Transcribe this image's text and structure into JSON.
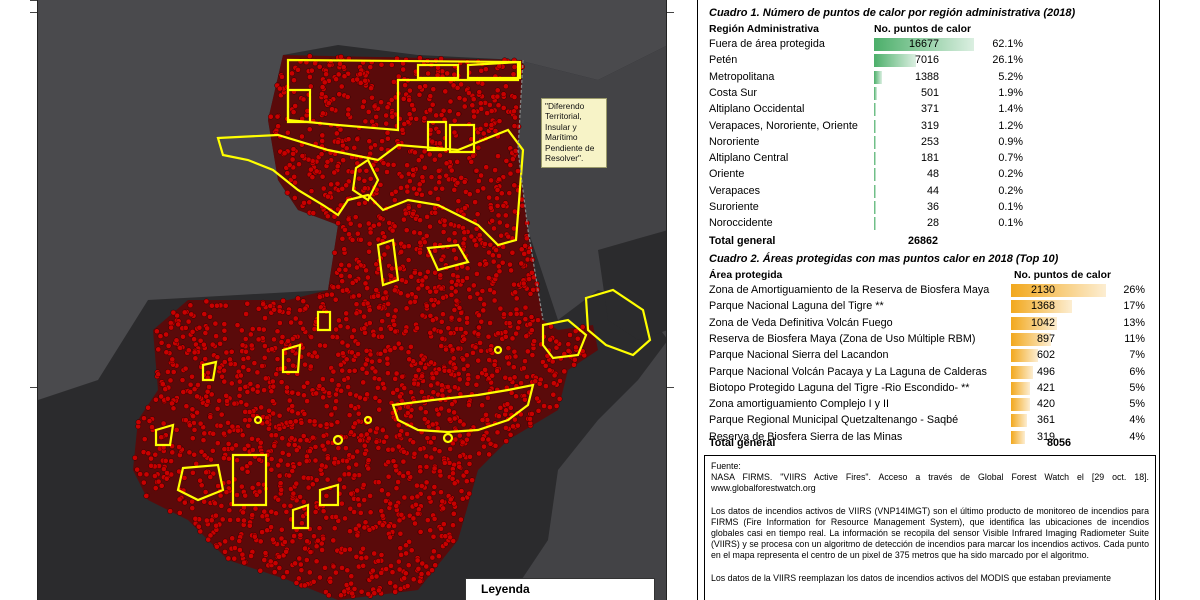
{
  "map": {
    "dispute_note": "\"Diferendo Territorial, Insular y Marítimo Pendiente de Resolver\".",
    "legend_title": "Leyenda"
  },
  "cuadro1": {
    "title": "Cuadro 1. Número de puntos de calor por región administrativa (2018)",
    "col_region": "Región Administrativa",
    "col_count": "No. puntos de calor",
    "bar_color": "#4caf6a",
    "rows": [
      {
        "region": "Fuera de área protegida",
        "count": 16677,
        "pct": "62.1%"
      },
      {
        "region": "Petén",
        "count": 7016,
        "pct": "26.1%"
      },
      {
        "region": "Metropolitana",
        "count": 1388,
        "pct": "5.2%"
      },
      {
        "region": "Costa Sur",
        "count": 501,
        "pct": "1.9%"
      },
      {
        "region": "Altiplano Occidental",
        "count": 371,
        "pct": "1.4%"
      },
      {
        "region": "Verapaces, Nororiente, Oriente",
        "count": 319,
        "pct": "1.2%"
      },
      {
        "region": "Nororiente",
        "count": 253,
        "pct": "0.9%"
      },
      {
        "region": "Altiplano Central",
        "count": 181,
        "pct": "0.7%"
      },
      {
        "region": "Oriente",
        "count": 48,
        "pct": "0.2%"
      },
      {
        "region": "Verapaces",
        "count": 44,
        "pct": "0.2%"
      },
      {
        "region": "Suroriente",
        "count": 36,
        "pct": "0.1%"
      },
      {
        "region": "Noroccidente",
        "count": 28,
        "pct": "0.1%"
      }
    ],
    "total_label": "Total general",
    "total_value": "26862"
  },
  "cuadro2": {
    "title": "Cuadro 2. Áreas protegidas con mas puntos calor en 2018 (Top 10)",
    "col_area": "Área protegida",
    "col_count": "No. puntos de calor",
    "bar_color": "#f2a81d",
    "rows": [
      {
        "area": "Zona de Amortiguamiento de la Reserva de Biosfera Maya",
        "count": 2130,
        "pct": "26%"
      },
      {
        "area": "Parque Nacional Laguna del Tigre **",
        "count": 1368,
        "pct": "17%"
      },
      {
        "area": "Zona de Veda Definitiva Volcán Fuego",
        "count": 1042,
        "pct": "13%"
      },
      {
        "area": "Reserva de Biosfera Maya (Zona de Uso Múltiple RBM)",
        "count": 897,
        "pct": "11%"
      },
      {
        "area": "Parque Nacional Sierra del Lacandon",
        "count": 602,
        "pct": "7%"
      },
      {
        "area": "Parque Nacional Volcán Pacaya y La Laguna de Calderas",
        "count": 496,
        "pct": "6%"
      },
      {
        "area": "Biotopo Protegido Laguna del Tigre -Rio Escondido- **",
        "count": 421,
        "pct": "5%"
      },
      {
        "area": "Zona amortiguamiento Complejo I y II",
        "count": 420,
        "pct": "5%"
      },
      {
        "area": "Parque Regional Municipal Quetzaltenango - Saqbé",
        "count": 361,
        "pct": "4%"
      },
      {
        "area": "Reserva de Biosfera Sierra de las Minas",
        "count": 319,
        "pct": "4%"
      }
    ],
    "total_label": "Total general",
    "total_value": "8056"
  },
  "source": {
    "label": "Fuente:",
    "citation": "NASA FIRMS. \"VIIRS Active Fires\". Acceso a través de Global Forest Watch el [29 oct. 18]. www.globalforestwatch.org",
    "para1": "Los datos de incendios activos de VIIRS (VNP14IMGT) son el último producto de monitoreo de incendios para FIRMS (Fire Information for Resource Management System), que identifica las ubicaciones de incendios globales casi en tiempo real. La información se recopila del sensor Visible Infrared Imaging Radiometer Suite (VIIRS) y se procesa con un algoritmo de detección de incendios para marcar los incendios activos. Cada punto en el mapa representa el centro de un pixel de 375 metros que ha sido marcado por el algoritmo.",
    "para2": "Los datos de la VIIRS reemplazan los datos de incendios activos del MODIS que estaban previamente"
  },
  "colors": {
    "hotspot": "#c80000",
    "protected_area_outline": "#ffff00",
    "map_background": "#2b2b2d",
    "land": "#4a4a4d"
  }
}
